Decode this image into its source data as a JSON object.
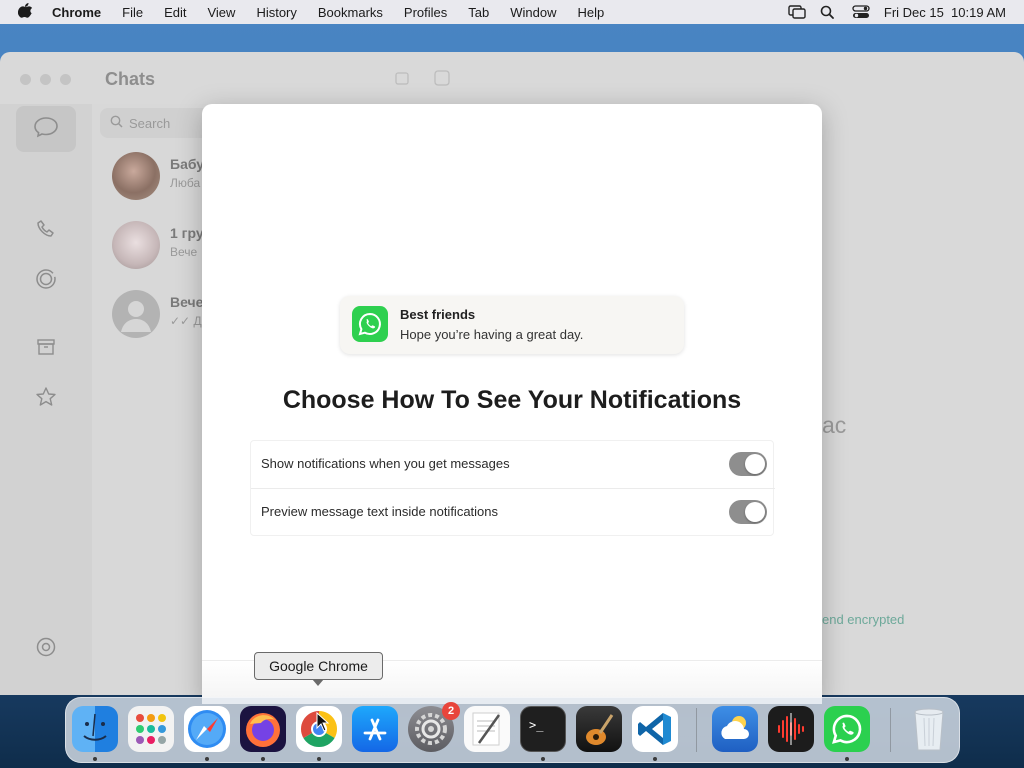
{
  "menubar": {
    "app_name": "Chrome",
    "items": [
      "File",
      "Edit",
      "View",
      "History",
      "Bookmarks",
      "Profiles",
      "Tab",
      "Window",
      "Help"
    ],
    "datetime": "Fri Dec 15  10:19 AM"
  },
  "whatsapp": {
    "title": "Chats",
    "search_placeholder": "Search",
    "chats": [
      {
        "name": "Бабу",
        "preview": "Люба"
      },
      {
        "name": "1 гру",
        "preview": "Вече"
      },
      {
        "name": "Вече",
        "preview": "✓✓ Д"
      }
    ],
    "background_fragment": "ac",
    "encrypted_fragment": "end encrypted"
  },
  "modal": {
    "notification": {
      "title": "Best friends",
      "body": "Hope you’re having a great day."
    },
    "heading": "Choose How To See Your Notifications",
    "options": [
      {
        "label": "Show notifications when you get messages",
        "enabled": true
      },
      {
        "label": "Preview message text inside notifications",
        "enabled": true
      }
    ]
  },
  "dock": {
    "tooltip": "Google Chrome",
    "apps": [
      {
        "name": "finder-icon",
        "running": true
      },
      {
        "name": "launchpad-icon",
        "running": false
      },
      {
        "name": "safari-icon",
        "running": true
      },
      {
        "name": "firefox-icon",
        "running": true
      },
      {
        "name": "chrome-icon",
        "running": true
      },
      {
        "name": "app-store-icon",
        "running": false
      },
      {
        "name": "system-settings-icon",
        "running": false,
        "badge": "2"
      },
      {
        "name": "textedit-icon",
        "running": false
      },
      {
        "name": "terminal-icon",
        "running": true
      },
      {
        "name": "garageband-icon",
        "running": false
      },
      {
        "name": "vscode-icon",
        "running": true
      },
      {
        "name": "weather-icon",
        "running": false
      },
      {
        "name": "voice-memos-icon",
        "running": false
      },
      {
        "name": "whatsapp-icon",
        "running": true
      },
      {
        "name": "trash-icon",
        "running": false
      }
    ]
  },
  "colors": {
    "whatsapp_green": "#2ed04f",
    "toggle_on": "#8e8e8e",
    "badge_red": "#e8453c"
  }
}
